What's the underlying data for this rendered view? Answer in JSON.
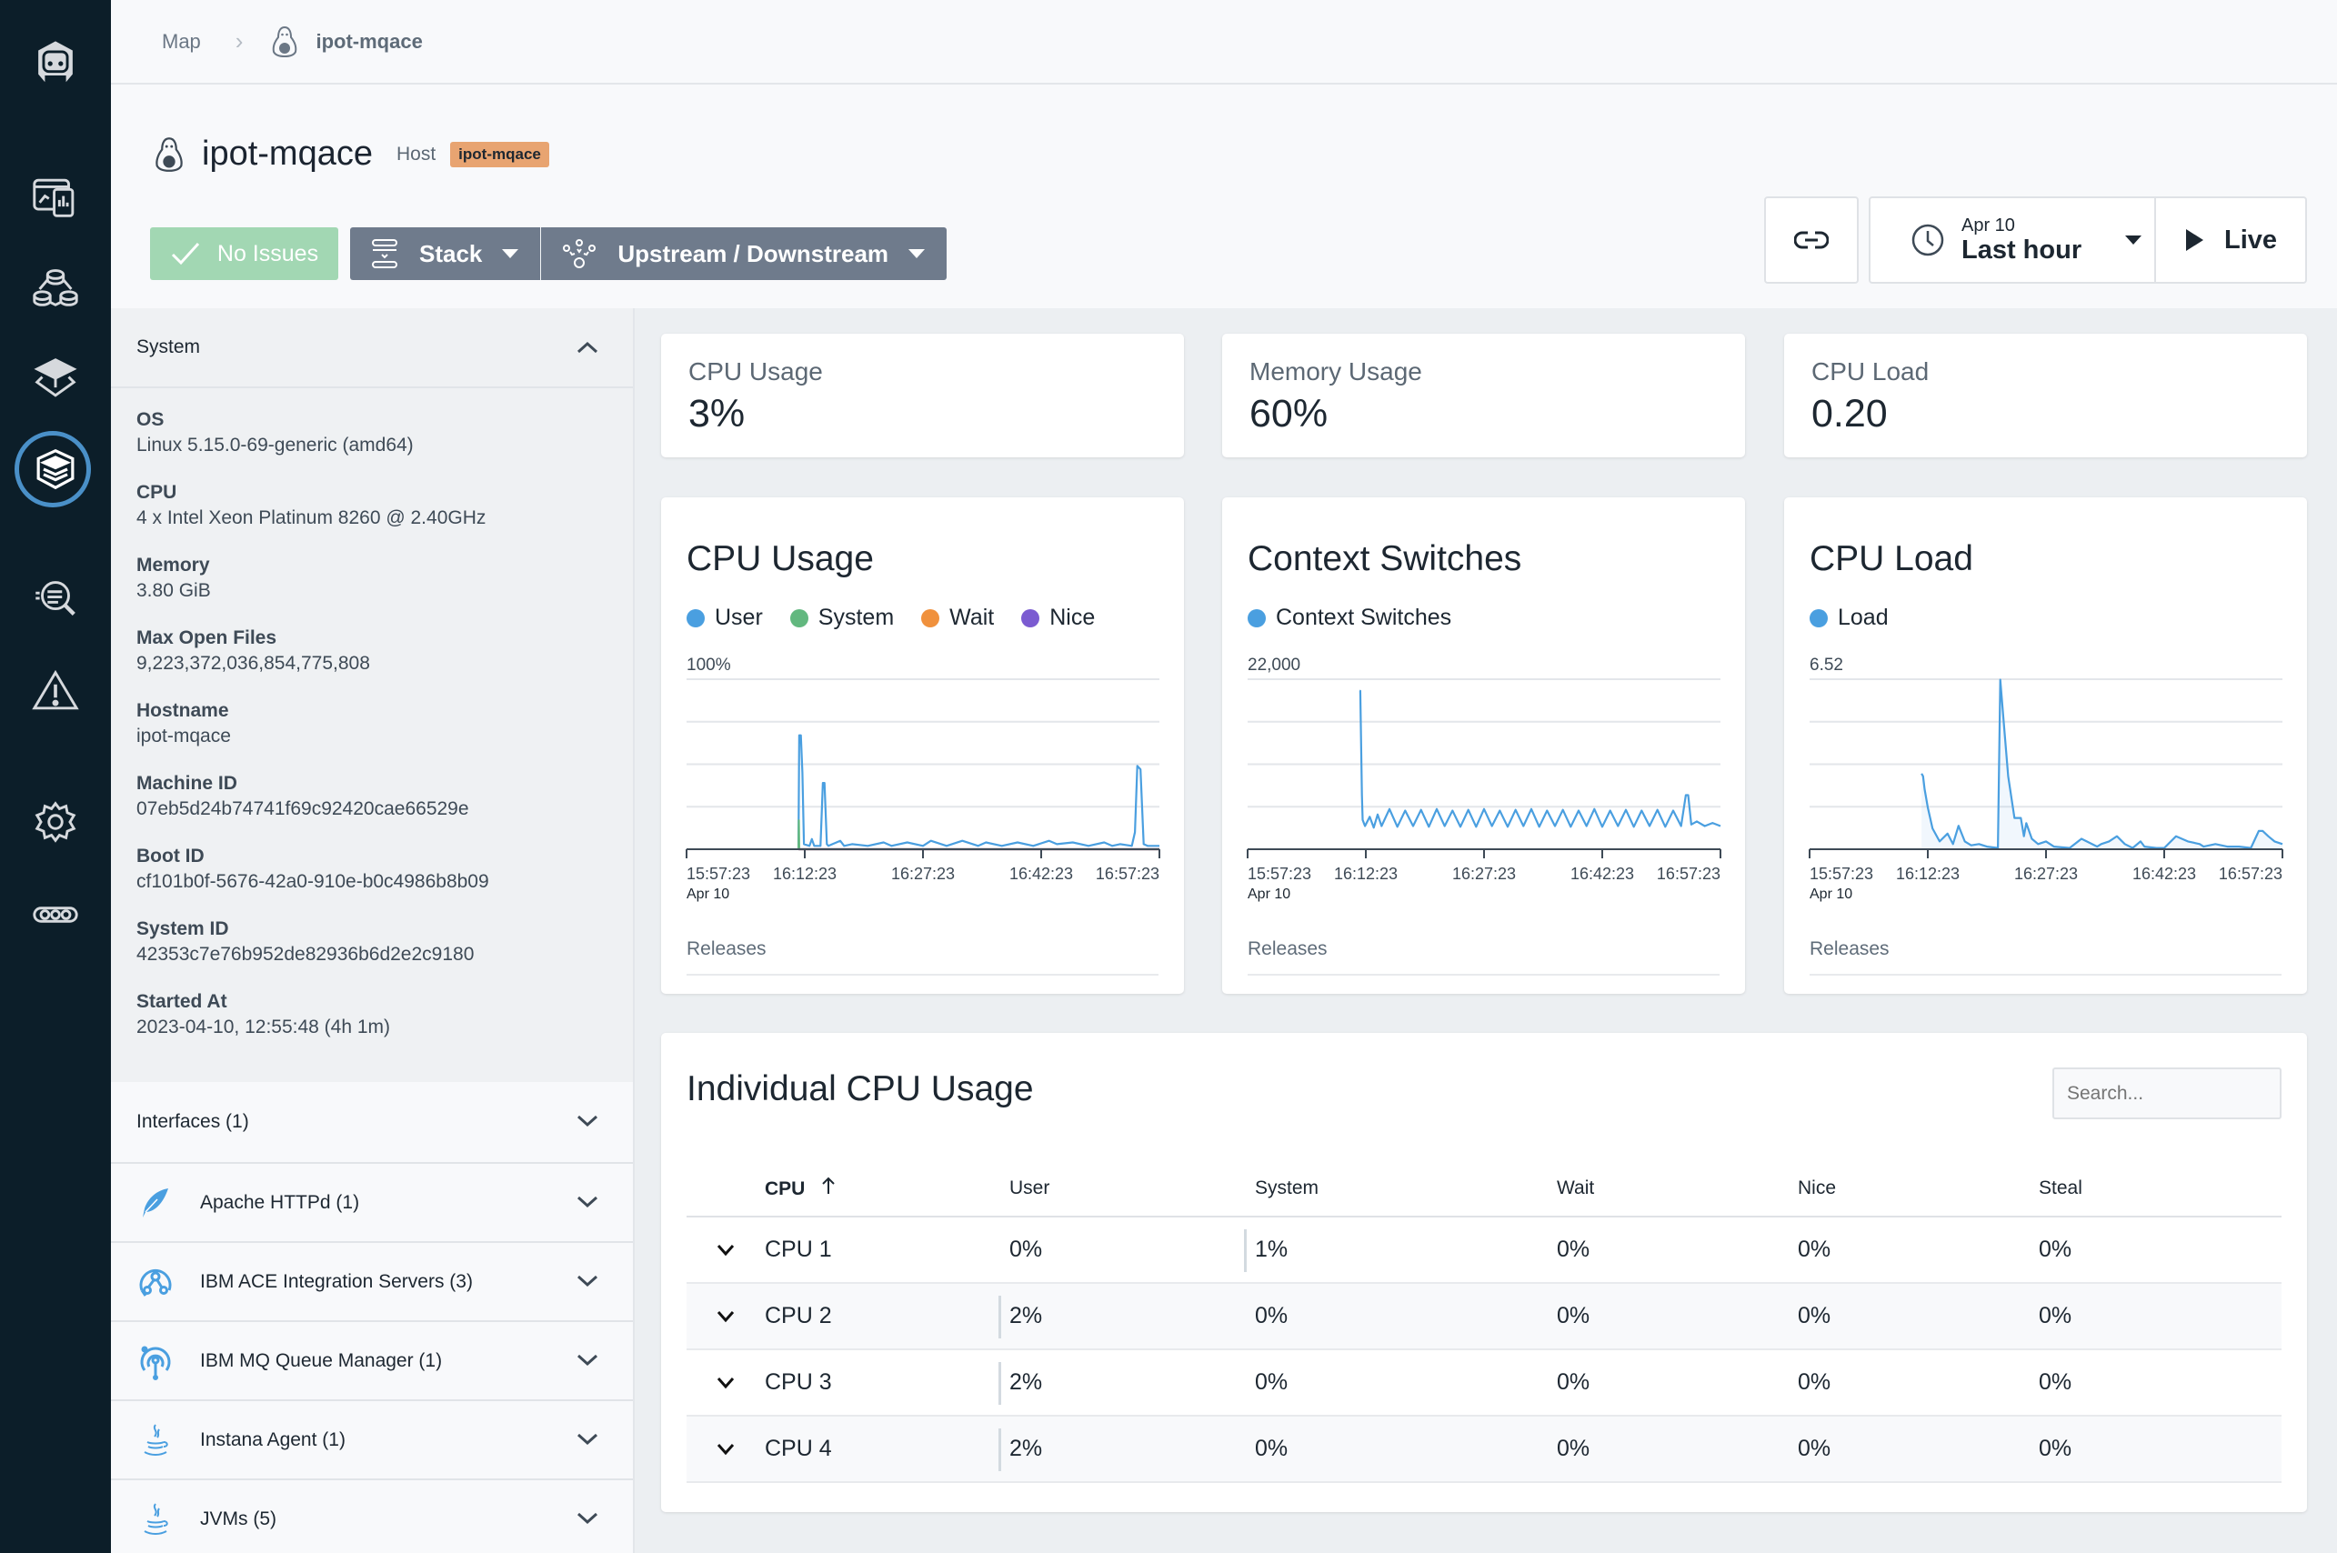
{
  "nav_rail": {
    "items": [
      {
        "icon": "instana-robot-logo-icon",
        "label": "Home"
      },
      {
        "icon": "websites-mobile-apps-icon",
        "label": "Websites & Mobile Apps"
      },
      {
        "icon": "applications-icon",
        "label": "Applications"
      },
      {
        "icon": "platforms-icon",
        "label": "Platforms"
      },
      {
        "icon": "infrastructure-stack-icon",
        "label": "Infrastructure",
        "active": true
      },
      {
        "icon": "analytics-search-icon",
        "label": "Analytics"
      },
      {
        "icon": "events-warning-icon",
        "label": "Events"
      },
      {
        "icon": "settings-gear-icon",
        "label": "Settings"
      },
      {
        "icon": "more-icon",
        "label": "More"
      }
    ],
    "accent_color": "#4a90c8"
  },
  "breadcrumb": {
    "root": "Map",
    "separator": ">",
    "current": "ipot-mqace"
  },
  "header": {
    "title": "ipot-mqace",
    "entity_type": "Host",
    "badge": "ipot-mqace",
    "badge_color": "#e8a471",
    "no_issues_label": "No Issues",
    "stack_label": "Stack",
    "upstream_label": "Upstream / Downstream",
    "time": {
      "date": "Apr 10",
      "range": "Last hour"
    },
    "live_label": "Live"
  },
  "system_panel": {
    "title": "System",
    "fields": [
      {
        "key": "OS",
        "value": "Linux 5.15.0-69-generic (amd64)"
      },
      {
        "key": "CPU",
        "value": "4 x Intel Xeon Platinum 8260 @ 2.40GHz"
      },
      {
        "key": "Memory",
        "value": "3.80 GiB"
      },
      {
        "key": "Max Open Files",
        "value": "9,223,372,036,854,775,808"
      },
      {
        "key": "Hostname",
        "value": "ipot-mqace"
      },
      {
        "key": "Machine ID",
        "value": "07eb5d24b74741f69c92420cae66529e"
      },
      {
        "key": "Boot ID",
        "value": "cf101b0f-5676-42a0-910e-b0c4986b8b09"
      },
      {
        "key": "System ID",
        "value": "42353c7e76b952de82936b6d2e2c9180"
      },
      {
        "key": "Started At",
        "value": "2023-04-10, 12:55:48 (4h 1m)"
      }
    ],
    "sections": [
      {
        "label": "Interfaces (1)",
        "icon": ""
      },
      {
        "label": "Apache HTTPd (1)",
        "icon": "apache-feather-icon"
      },
      {
        "label": "IBM ACE Integration Servers (3)",
        "icon": "ibm-ace-icon"
      },
      {
        "label": "IBM MQ Queue Manager (1)",
        "icon": "ibm-mq-icon"
      },
      {
        "label": "Instana Agent (1)",
        "icon": "java-icon"
      },
      {
        "label": "JVMs (5)",
        "icon": "java-icon"
      }
    ]
  },
  "summary": [
    {
      "label": "CPU Usage",
      "value": "3%"
    },
    {
      "label": "Memory Usage",
      "value": "60%"
    },
    {
      "label": "CPU Load",
      "value": "0.20"
    }
  ],
  "releases_label": "Releases",
  "chart_data": [
    {
      "type": "line",
      "title": "CPU Usage",
      "ylabel": "",
      "ylim": [
        0,
        100
      ],
      "ymax_label": "100%",
      "gridlines": 4,
      "x_ticks": [
        "15:57:23",
        "16:12:23",
        "16:27:23",
        "16:42:23",
        "16:57:23"
      ],
      "x_subtick": "Apr 10",
      "xlim_minutes": [
        0,
        60
      ],
      "legend": [
        {
          "name": "User",
          "color": "#4a9fe0"
        },
        {
          "name": "System",
          "color": "#62b87f"
        },
        {
          "name": "Wait",
          "color": "#f0913d"
        },
        {
          "name": "Nice",
          "color": "#7b5bd1"
        }
      ],
      "series": [
        {
          "name": "User",
          "color": "#4a9fe0",
          "x": [
            14.2,
            14.3,
            14.5,
            14.7,
            14.9,
            15.6,
            15.9,
            16.2,
            17.0,
            17.3,
            17.5,
            17.8,
            18.0,
            19.5,
            20.0,
            21.0,
            23.0,
            25.0,
            26.0,
            28.0,
            30.0,
            31.0,
            33.0,
            35.0,
            37.0,
            38.0,
            40.0,
            42.0,
            44.0,
            46.0,
            47.0,
            49.0,
            51.0,
            53.0,
            54.0,
            55.0,
            56.5,
            56.9,
            57.2,
            57.6,
            58.0,
            58.5,
            60.0
          ],
          "values": [
            2,
            67,
            67,
            45,
            3,
            2,
            6,
            2,
            2,
            39,
            39,
            3,
            2,
            5,
            2,
            3,
            2,
            4,
            2,
            4,
            2,
            5,
            2,
            5,
            2,
            4,
            2,
            4,
            2,
            5,
            3,
            4,
            2,
            4,
            2,
            3,
            2,
            10,
            49,
            47,
            3,
            2,
            2
          ]
        },
        {
          "name": "System",
          "color": "#62b87f",
          "x": [
            14.2,
            14.25,
            14.3,
            60.0
          ],
          "values": [
            0,
            17,
            0,
            0
          ]
        },
        {
          "name": "Wait",
          "color": "#f0913d",
          "x": [
            14.2,
            60.0
          ],
          "values": [
            0,
            0
          ]
        },
        {
          "name": "Nice",
          "color": "#7b5bd1",
          "x": [
            14.2,
            60.0
          ],
          "values": [
            0,
            0
          ]
        }
      ]
    },
    {
      "type": "line",
      "title": "Context Switches",
      "ylim": [
        0,
        22000
      ],
      "ymax_label": "22,000",
      "gridlines": 4,
      "x_ticks": [
        "15:57:23",
        "16:12:23",
        "16:27:23",
        "16:42:23",
        "16:57:23"
      ],
      "x_subtick": "Apr 10",
      "xlim_minutes": [
        0,
        60
      ],
      "legend": [
        {
          "name": "Context Switches",
          "color": "#4a9fe0"
        }
      ],
      "series": [
        {
          "name": "Context Switches",
          "color": "#4a9fe0",
          "x": [
            14.2,
            14.3,
            14.5,
            14.6,
            14.9,
            15.5,
            16.0,
            16.5,
            17.0,
            18.0,
            19.0,
            20.0,
            21.0,
            22.0,
            23.0,
            24.0,
            25.0,
            26.0,
            27.0,
            28.0,
            29.0,
            30.0,
            31.0,
            32.0,
            33.0,
            34.0,
            35.0,
            36.0,
            37.0,
            38.0,
            39.0,
            40.0,
            41.0,
            42.0,
            43.0,
            44.0,
            45.0,
            46.0,
            47.0,
            48.0,
            49.0,
            50.0,
            51.0,
            52.0,
            53.0,
            54.0,
            55.0,
            55.6,
            55.9,
            56.3,
            57.0,
            58.0,
            59.0,
            60.0
          ],
          "values": [
            20500,
            20500,
            7000,
            3800,
            3000,
            4200,
            2800,
            4500,
            3000,
            5200,
            2900,
            5000,
            3000,
            5100,
            2900,
            5200,
            3000,
            5000,
            2900,
            5100,
            2900,
            5200,
            3000,
            5000,
            2900,
            5100,
            3000,
            5200,
            2900,
            5000,
            3000,
            5100,
            2900,
            5000,
            3000,
            5200,
            2900,
            5000,
            3000,
            5100,
            2900,
            5000,
            3000,
            5100,
            2900,
            5000,
            3000,
            7000,
            7000,
            3200,
            3600,
            3000,
            3400,
            3000
          ]
        }
      ]
    },
    {
      "type": "area",
      "title": "CPU Load",
      "ylim": [
        0,
        6.52
      ],
      "ymax_label": "6.52",
      "gridlines": 4,
      "x_ticks": [
        "15:57:23",
        "16:12:23",
        "16:27:23",
        "16:42:23",
        "16:57:23"
      ],
      "x_subtick": "Apr 10",
      "xlim_minutes": [
        0,
        60
      ],
      "legend": [
        {
          "name": "Load",
          "color": "#4a9fe0"
        }
      ],
      "series": [
        {
          "name": "Load",
          "color": "#4a9fe0",
          "x": [
            14.2,
            14.4,
            14.6,
            15.0,
            15.6,
            16.5,
            17.5,
            18.2,
            18.9,
            19.7,
            20.5,
            21.5,
            22.5,
            23.9,
            24.2,
            24.6,
            25.2,
            26.0,
            26.8,
            27.2,
            27.5,
            28.2,
            29.0,
            30.0,
            31.0,
            33.0,
            34.5,
            36.5,
            37.0,
            38.0,
            39.0,
            40.0,
            41.0,
            42.0,
            42.5,
            44.0,
            45.0,
            46.5,
            48.0,
            49.5,
            50.0,
            51.5,
            53.0,
            54.5,
            56.0,
            57.0,
            57.5,
            58.2,
            59.0,
            60.0
          ],
          "values": [
            2.9,
            2.8,
            2.3,
            1.6,
            0.8,
            0.3,
            0.6,
            0.2,
            0.9,
            0.3,
            0.15,
            0.2,
            0.1,
            0.05,
            6.5,
            5.0,
            2.8,
            1.2,
            1.2,
            0.5,
            1.0,
            0.4,
            0.2,
            0.3,
            0.1,
            0.05,
            0.4,
            0.1,
            0.2,
            0.3,
            0.5,
            0.2,
            0.05,
            0.3,
            0.1,
            0.05,
            0.05,
            0.5,
            0.3,
            0.2,
            0.1,
            0.2,
            0.1,
            0.1,
            0.05,
            0.7,
            0.7,
            0.5,
            0.3,
            0.2
          ]
        }
      ]
    }
  ],
  "cpu_table": {
    "title": "Individual CPU Usage",
    "search_placeholder": "Search...",
    "columns": [
      "CPU",
      "User",
      "System",
      "Wait",
      "Nice",
      "Steal"
    ],
    "sort": {
      "column": "CPU",
      "direction": "ascending"
    },
    "rows": [
      {
        "cpu": "CPU 1",
        "user": "0%",
        "system": "1%",
        "wait": "0%",
        "nice": "0%",
        "steal": "0%",
        "dominant": "system"
      },
      {
        "cpu": "CPU 2",
        "user": "2%",
        "system": "0%",
        "wait": "0%",
        "nice": "0%",
        "steal": "0%",
        "dominant": "user"
      },
      {
        "cpu": "CPU 3",
        "user": "2%",
        "system": "0%",
        "wait": "0%",
        "nice": "0%",
        "steal": "0%",
        "dominant": "user"
      },
      {
        "cpu": "CPU 4",
        "user": "2%",
        "system": "0%",
        "wait": "0%",
        "nice": "0%",
        "steal": "0%",
        "dominant": "user"
      }
    ]
  }
}
